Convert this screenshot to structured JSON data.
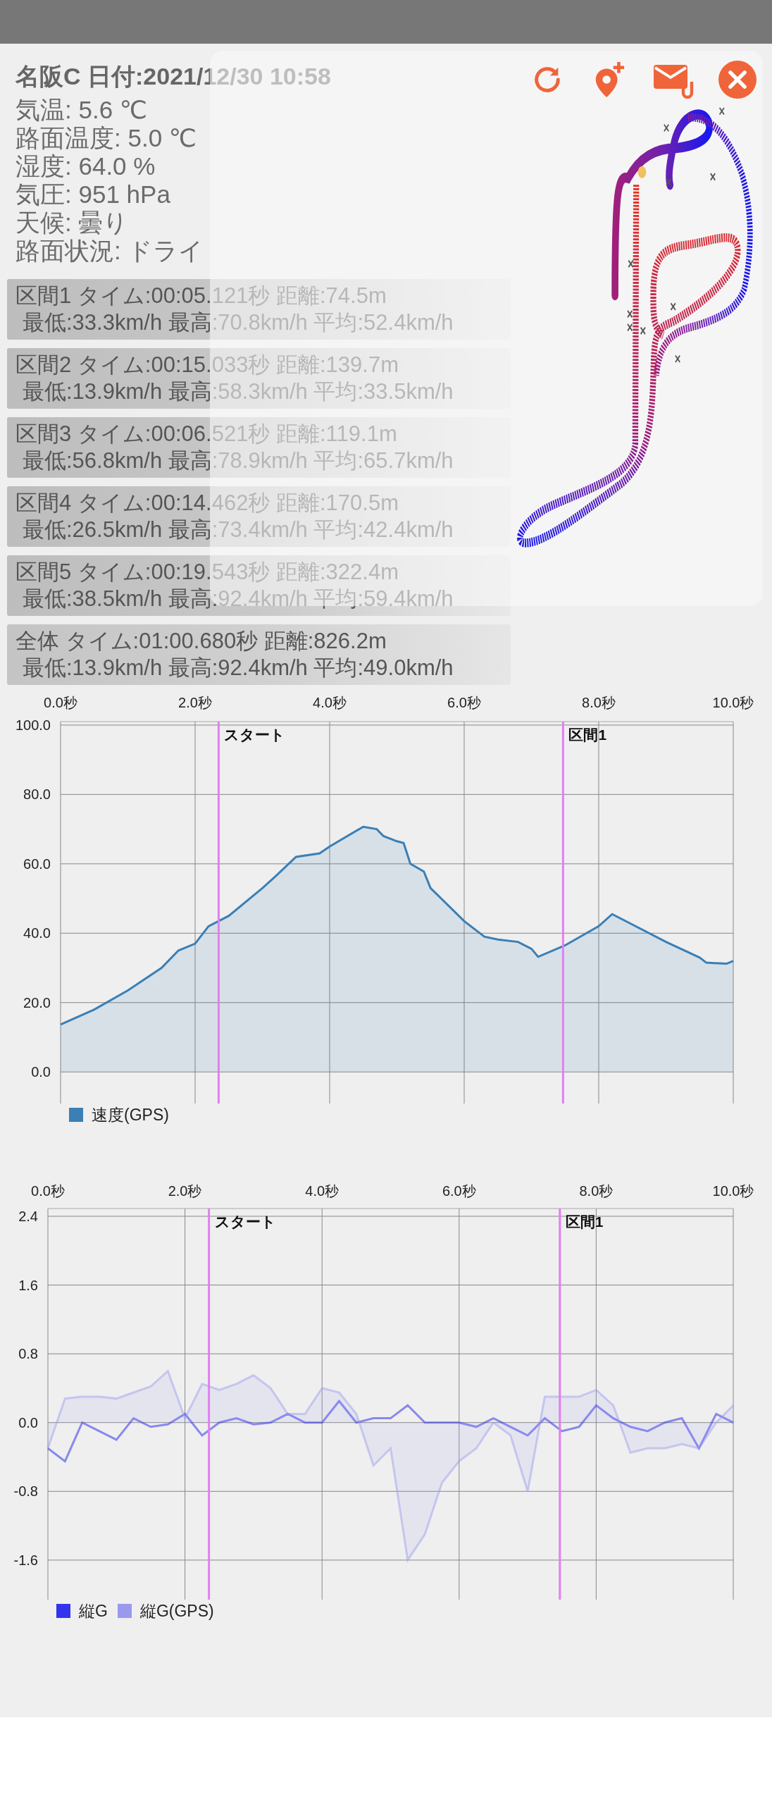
{
  "header": {
    "title": "名阪C 日付:2021/12/30 10:58"
  },
  "conditions": [
    "気温: 5.6 ℃",
    "路面温度: 5.0 ℃",
    "湿度: 64.0 %",
    "気圧: 951 hPa",
    "天候: 曇り",
    "路面状況: ドライ"
  ],
  "sections": [
    {
      "kind": "section",
      "line1": "区間1 タイム:00:05.121秒 距離:74.5m",
      "line2": "最低:33.3km/h 最高:70.8km/h 平均:52.4km/h"
    },
    {
      "kind": "section",
      "line1": "区間2 タイム:00:15.033秒 距離:139.7m",
      "line2": "最低:13.9km/h 最高:58.3km/h 平均:33.5km/h"
    },
    {
      "kind": "section",
      "line1": "区間3 タイム:00:06.521秒 距離:119.1m",
      "line2": "最低:56.8km/h 最高:78.9km/h 平均:65.7km/h"
    },
    {
      "kind": "section",
      "line1": "区間4 タイム:00:14.462秒 距離:170.5m",
      "line2": "最低:26.5km/h 最高:73.4km/h 平均:42.4km/h"
    },
    {
      "kind": "section",
      "line1": "区間5 タイム:00:19.543秒 距離:322.4m",
      "line2": "最低:38.5km/h 最高:92.4km/h 平均:59.4km/h"
    },
    {
      "kind": "total",
      "line1": "全体  タイム:01:00.680秒 距離:826.2m",
      "line2": "最低:13.9km/h 最高:92.4km/h 平均:49.0km/h"
    }
  ],
  "speed_chart": {
    "chart_data": {
      "type": "area",
      "xlim": [
        0,
        10
      ],
      "ylim": [
        -9.1,
        101
      ],
      "xticks": [
        {
          "value": 0,
          "label": "0.0秒"
        },
        {
          "value": 2,
          "label": "2.0秒"
        },
        {
          "value": 4,
          "label": "4.0秒"
        },
        {
          "value": 6,
          "label": "6.0秒"
        },
        {
          "value": 8,
          "label": "8.0秒"
        },
        {
          "value": 10,
          "label": "10.0秒"
        }
      ],
      "yticks": [
        {
          "value": 0,
          "label": "0.0"
        },
        {
          "value": 20,
          "label": "20.0"
        },
        {
          "value": 40,
          "label": "40.0"
        },
        {
          "value": 60,
          "label": "60.0"
        },
        {
          "value": 80,
          "label": "80.0"
        },
        {
          "value": 100,
          "label": "100.0"
        }
      ],
      "x": [
        0,
        0.5,
        1,
        1.5,
        1.75,
        2,
        2.2,
        2.5,
        3,
        3.2,
        3.5,
        3.85,
        4,
        4.5,
        4.7,
        4.8,
        5,
        5.1,
        5.2,
        5.4,
        5.5,
        6,
        6.3,
        6.5,
        6.8,
        7,
        7.1,
        7.5,
        8,
        8.2,
        8.5,
        9,
        9.5,
        9.6,
        9.9,
        10
      ],
      "series": [
        {
          "name": "速度(GPS)",
          "color": "#3a7fb5",
          "values": [
            13.7,
            18,
            23.5,
            30,
            35,
            37,
            42,
            45,
            53,
            56.5,
            62,
            63,
            65,
            70.7,
            70,
            68,
            66.5,
            66,
            60,
            57.8,
            53,
            43.5,
            39,
            38.2,
            37.5,
            35.5,
            33.2,
            36.5,
            42,
            45.5,
            42.5,
            37.5,
            33,
            31.5,
            31.2,
            32
          ]
        }
      ],
      "grid": true,
      "ref_lines": [
        {
          "axis": "x",
          "value": 2.35,
          "label": "スタート",
          "color": "#e080f0"
        },
        {
          "axis": "x",
          "value": 7.47,
          "label": "区間1",
          "color": "#e080f0"
        }
      ]
    }
  },
  "g_chart": {
    "chart_data": {
      "type": "area",
      "xlim": [
        0,
        10
      ],
      "ylim": [
        -2.06,
        2.49
      ],
      "xticks": [
        {
          "value": 0,
          "label": "0.0秒"
        },
        {
          "value": 2,
          "label": "2.0秒"
        },
        {
          "value": 4,
          "label": "4.0秒"
        },
        {
          "value": 6,
          "label": "6.0秒"
        },
        {
          "value": 8,
          "label": "8.0秒"
        },
        {
          "value": 10,
          "label": "10.0秒"
        }
      ],
      "yticks": [
        {
          "value": -1.6,
          "label": "-1.6"
        },
        {
          "value": -0.8,
          "label": "-0.8"
        },
        {
          "value": 0,
          "label": "0.0"
        },
        {
          "value": 0.8,
          "label": "0.8"
        },
        {
          "value": 1.6,
          "label": "1.6"
        },
        {
          "value": 2.4,
          "label": "2.4"
        }
      ],
      "x": [
        0,
        0.25,
        0.5,
        0.75,
        1,
        1.25,
        1.5,
        1.75,
        2,
        2.25,
        2.5,
        2.75,
        3,
        3.25,
        3.5,
        3.75,
        4,
        4.25,
        4.5,
        4.75,
        5,
        5.25,
        5.5,
        5.75,
        6,
        6.25,
        6.5,
        6.75,
        7,
        7.25,
        7.5,
        7.75,
        8,
        8.25,
        8.5,
        8.75,
        9,
        9.25,
        9.5,
        9.75,
        10
      ],
      "series": [
        {
          "name": "縦G",
          "color": "#3333ee",
          "type": "line",
          "values": [
            -0.3,
            -0.45,
            0,
            -0.1,
            -0.2,
            0.05,
            -0.05,
            -0.02,
            0.1,
            -0.15,
            0,
            0.05,
            -0.02,
            0,
            0.1,
            0,
            0,
            0.25,
            0,
            0.05,
            0.05,
            0.2,
            0,
            0,
            0,
            -0.05,
            0.05,
            -0.05,
            -0.15,
            0.05,
            -0.1,
            -0.05,
            0.2,
            0.05,
            -0.05,
            -0.1,
            0,
            0.05,
            -0.3,
            0.1,
            0
          ]
        },
        {
          "name": "縦G(GPS)",
          "color": "#9999ee",
          "values": [
            -0.3,
            0.28,
            0.3,
            0.3,
            0.28,
            0.35,
            0.42,
            0.6,
            0.05,
            0.45,
            0.38,
            0.45,
            0.55,
            0.4,
            0.1,
            0.1,
            0.4,
            0.35,
            0.1,
            -0.5,
            -0.3,
            -1.6,
            -1.3,
            -0.7,
            -0.45,
            -0.3,
            0,
            -0.15,
            -0.8,
            0.3,
            0.3,
            0.3,
            0.38,
            0.2,
            -0.35,
            -0.3,
            -0.3,
            -0.25,
            -0.3,
            0,
            0.2
          ]
        }
      ],
      "grid": true,
      "ref_lines": [
        {
          "axis": "x",
          "value": 2.35,
          "label": "スタート",
          "color": "#e080f0"
        },
        {
          "axis": "x",
          "value": 7.47,
          "label": "区間1",
          "color": "#e080f0"
        }
      ]
    }
  }
}
